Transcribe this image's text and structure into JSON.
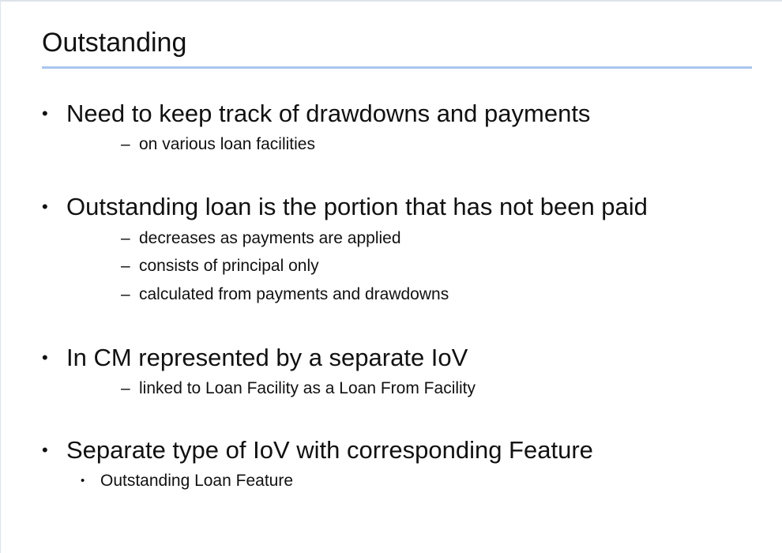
{
  "slide": {
    "title": "Outstanding",
    "bullets": [
      {
        "text": "Need to keep track of drawdowns and payments",
        "subs": [
          "on various loan facilities"
        ]
      },
      {
        "text": "Outstanding loan is the portion that has not been paid",
        "subs": [
          "decreases as payments are applied",
          "consists of principal only",
          "calculated from payments and drawdowns"
        ]
      },
      {
        "text": "In CM represented by a separate IoV",
        "subs": [
          "linked to Loan Facility as a Loan From Facility"
        ]
      },
      {
        "text": "Separate type of IoV with corresponding Feature",
        "subs": [
          "Outstanding Loan Feature"
        ]
      }
    ],
    "bullet_marker": "•",
    "sub_marker": "–",
    "accent_color": "#a9c6ef"
  }
}
